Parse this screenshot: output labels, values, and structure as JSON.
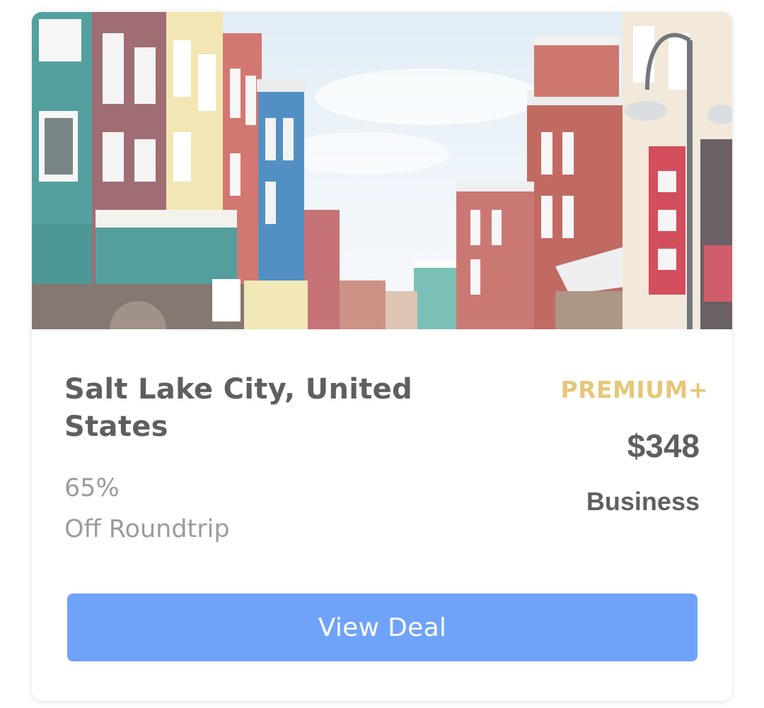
{
  "deal": {
    "image_alt": "Colorful snowy main street with multi-story buildings",
    "destination": "Salt Lake City, United States",
    "discount_percent": "65%",
    "discount_text": "Off Roundtrip",
    "tier": "PREMIUM+",
    "price": "$348",
    "cabin": "Business",
    "cta_label": "View Deal"
  },
  "colors": {
    "tier_gold": "#e5c77a",
    "cta_blue": "#6fa3fa",
    "heading_gray": "#5f5f5f",
    "muted_gray": "#9b9b9b"
  }
}
